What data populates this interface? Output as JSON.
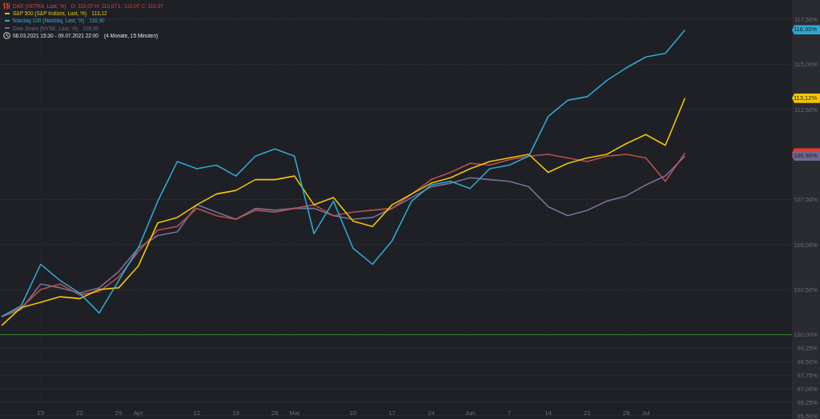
{
  "legend": {
    "items": [
      {
        "kind": "ohlc",
        "name": "DAX (XETRA, Last, %)",
        "values": "O: 110,07  H: 110,07  L: 110,07  C: 110,07",
        "color": "#d9443b"
      },
      {
        "kind": "line",
        "name": "S&P 500 (S&P Indizes, Last, %)",
        "values": "113,12",
        "color": "#e8c10a"
      },
      {
        "kind": "line",
        "name": "Nasdaq-100 (Nasdaq, Last, %)",
        "values": "116,90",
        "color": "#2ea8d0"
      },
      {
        "kind": "line",
        "name": "Dow Jones (NYSE, Last, %)",
        "values": "109,90",
        "color": "#6e6a85"
      }
    ],
    "period": {
      "range": "08.03.2021 15:30 - 09.07.2021 22:00",
      "span": "(4 Monate, 15 Minuten)"
    }
  },
  "price_tags": [
    {
      "label": "116,90%",
      "color": "#2ea8d0"
    },
    {
      "label": "113,12%",
      "color": "#f5c400"
    },
    {
      "color": "#e53935"
    },
    {
      "label": "109,90%",
      "color": "#6e6a8f"
    }
  ],
  "chart": {
    "chart_data": {
      "type": "line",
      "categories": [
        null,
        null,
        "15",
        null,
        "22",
        null,
        "29",
        "Apr",
        null,
        null,
        "12",
        null,
        "19",
        null,
        "26",
        "Mai",
        null,
        null,
        "10",
        null,
        "17",
        null,
        "24",
        null,
        "Jun",
        null,
        "7",
        null,
        "14",
        null,
        "21",
        null,
        "28",
        "Jul",
        null,
        null
      ],
      "series": [
        {
          "color": "#2ea8d0",
          "values": [
            101,
            101.6,
            103.9,
            103,
            102.3,
            101.2,
            103,
            104.8,
            107.4,
            109.6,
            109.2,
            109.4,
            108.8,
            109.9,
            110.3,
            109.9,
            105.6,
            107.4,
            104.8,
            103.9,
            105.2,
            107.4,
            108.3,
            108.5,
            108.1,
            109.2,
            109.4,
            109.9,
            112.1,
            113,
            113.2,
            114.1,
            114.8,
            115.4,
            115.6,
            116.9
          ]
        },
        {
          "color": "#f5c400",
          "values": [
            100.5,
            101.5,
            101.8,
            102.1,
            102,
            102.5,
            102.6,
            103.8,
            106.2,
            106.5,
            107.2,
            107.8,
            108,
            108.6,
            108.6,
            108.8,
            107.2,
            107.6,
            106.3,
            106,
            107.2,
            107.8,
            108.4,
            108.7,
            109.2,
            109.6,
            109.8,
            110,
            109,
            109.5,
            109.8,
            110,
            110.6,
            111.1,
            110.5,
            113.12
          ]
        },
        {
          "color": "#b9504a",
          "values": [
            101,
            101.5,
            102.5,
            102.8,
            102.2,
            102.4,
            103.2,
            104.6,
            105.8,
            106,
            107,
            106.6,
            106.4,
            106.9,
            106.8,
            107,
            107.2,
            106.6,
            106.8,
            106.9,
            107,
            107.8,
            108.6,
            109,
            109.5,
            109.4,
            109.7,
            109.9,
            110,
            109.8,
            109.6,
            109.9,
            110,
            109.8,
            108.5,
            110.07
          ]
        },
        {
          "color": "#77709a",
          "values": [
            101,
            101.4,
            102.8,
            102.6,
            102.3,
            102.6,
            103.5,
            104.8,
            105.5,
            105.7,
            107.2,
            106.8,
            106.4,
            107,
            106.9,
            107,
            107,
            106.6,
            106.4,
            106.5,
            107,
            107.6,
            108.2,
            108.4,
            108.7,
            108.6,
            108.5,
            108.2,
            107.1,
            106.6,
            106.9,
            107.4,
            107.7,
            108.3,
            108.8,
            109.9
          ]
        }
      ],
      "ylim": [
        95.32,
        118.56
      ],
      "yticks": [
        {
          "value": 117.5,
          "label": "117,50%"
        },
        {
          "value": 115,
          "label": "115,00%"
        },
        {
          "value": 112.5,
          "label": "112,50%"
        },
        {
          "value": 107.5,
          "label": "107,50%"
        },
        {
          "value": 105,
          "label": "105,00%"
        },
        {
          "value": 102.5,
          "label": "102,50%"
        },
        {
          "value": 100,
          "label": "100,00%"
        },
        {
          "value": 99.25,
          "label": "99,25%"
        },
        {
          "value": 98.5,
          "label": "98,50%"
        },
        {
          "value": 97.75,
          "label": "97,75%"
        },
        {
          "value": 97,
          "label": "97,00%"
        },
        {
          "value": 96.25,
          "label": "96,25%"
        },
        {
          "value": 95.5,
          "label": "95,50%"
        }
      ],
      "grid": true,
      "ref_lines": [
        {
          "axis": "y",
          "value": 100,
          "color": "#3d7a35"
        }
      ]
    }
  }
}
